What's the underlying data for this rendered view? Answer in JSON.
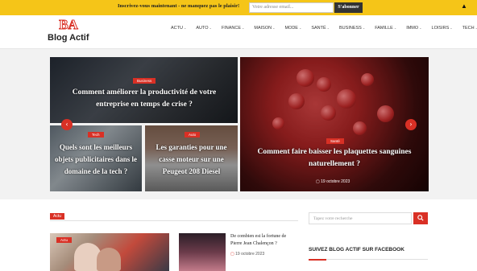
{
  "topbar": {
    "message": "Inscrivez-vous maintenant - ne manquez pas le plaisir!",
    "email_placeholder": "Votre adresse email...",
    "subscribe_label": "S'abonner",
    "close_icon": "▲"
  },
  "header": {
    "logo_mark": "BA",
    "logo_text": "Blog Actif",
    "nav": [
      {
        "label": "ACTU"
      },
      {
        "label": "AUTO"
      },
      {
        "label": "FINANCE"
      },
      {
        "label": "MAISON"
      },
      {
        "label": "MODE"
      },
      {
        "label": "SANTÉ"
      },
      {
        "label": "BUSINESS"
      },
      {
        "label": "FAMILLE"
      },
      {
        "label": "IMMO"
      },
      {
        "label": "LOISIRS"
      },
      {
        "label": "TECH"
      }
    ]
  },
  "hero": {
    "tile1": {
      "tag": "Business",
      "title": "Comment améliorer la productivité de votre entreprise en temps de crise ?"
    },
    "tile2": {
      "tag": "Tech",
      "title": "Quels sont les meilleurs objets publicitaires dans le domaine de la tech ?"
    },
    "tile3": {
      "tag": "Auto",
      "title": "Les garanties pour une casse moteur sur une Peugeot 208 Diesel"
    },
    "tile4": {
      "tag": "Santé",
      "title": "Comment faire baisser les plaquettes sanguines naturellement ?",
      "date": "19 octobre 2023"
    },
    "prev_arrow": "‹",
    "next_arrow": "›"
  },
  "content": {
    "section_tag": "Actu",
    "card_tag": "Actu",
    "side_article": {
      "title": "De combien est la fortune de Pierre Jean Chalençon ?",
      "date": "19 octobre 2023"
    }
  },
  "sidebar": {
    "search_placeholder": "Tapez votre recherche",
    "search_icon": "🔍",
    "facebook_title": "SUIVEZ BLOG ACTIF SUR FACEBOOK"
  },
  "colors": {
    "accent": "#d93025",
    "topbar": "#f5c518"
  }
}
